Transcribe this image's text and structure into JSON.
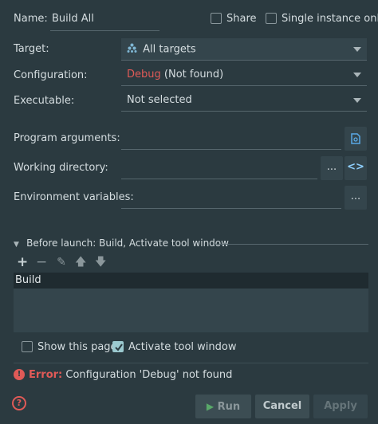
{
  "form": {
    "name_label": "Name:",
    "name_value": "Build All",
    "share_label": "Share",
    "single_instance_label": "Single instance only",
    "target_label": "Target:",
    "target_value": "All targets",
    "configuration_label": "Configuration:",
    "configuration_value_red": "Debug",
    "configuration_value_rest": " (Not found)",
    "executable_label": "Executable:",
    "executable_value": "Not selected",
    "program_arguments_label": "Program arguments:",
    "working_directory_label": "Working directory:",
    "working_directory_browse": "...",
    "working_directory_macro": "<>",
    "environment_variables_label": "Environment variables:",
    "environment_variables_browse": "..."
  },
  "before_launch": {
    "header": "Before launch: Build, Activate tool window",
    "items": [
      "Build"
    ],
    "show_this_page_label": "Show this page",
    "show_this_page_checked": false,
    "activate_tool_window_label": "Activate tool window",
    "activate_tool_window_checked": true
  },
  "error": {
    "prefix": "Error:",
    "message": "Configuration 'Debug' not found"
  },
  "footer": {
    "run_label": "Run",
    "cancel_label": "Cancel",
    "apply_label": "Apply"
  },
  "colors": {
    "background": "#2b3a40",
    "error_red": "#e05a57",
    "accent": "#9bc9cf"
  }
}
